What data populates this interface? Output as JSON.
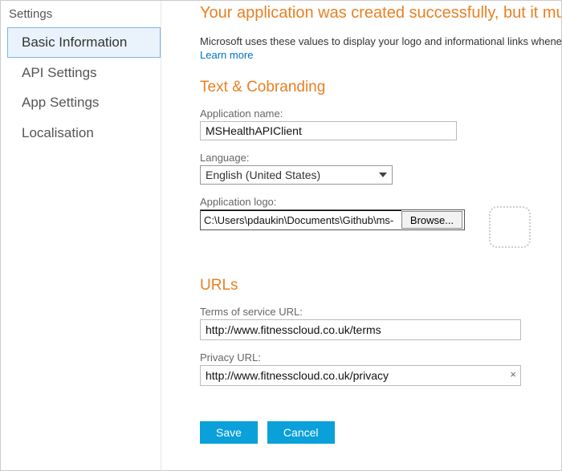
{
  "sidebar": {
    "title": "Settings",
    "items": [
      {
        "label": "Basic Information",
        "active": true
      },
      {
        "label": "API Settings",
        "active": false
      },
      {
        "label": "App Settings",
        "active": false
      },
      {
        "label": "Localisation",
        "active": false
      }
    ]
  },
  "alert": {
    "heading": "Your application was created successfully, but it must be co",
    "desc": "Microsoft uses these values to display your logo and informational links whenev",
    "learn_more": "Learn more"
  },
  "sections": {
    "cobranding": {
      "title": "Text & Cobranding",
      "app_name_label": "Application name:",
      "app_name_value": "MSHealthAPIClient",
      "language_label": "Language:",
      "language_value": "English (United States)",
      "app_logo_label": "Application logo:",
      "app_logo_path": "C:\\Users\\pdaukin\\Documents\\Github\\ms-",
      "browse_label": "Browse..."
    },
    "urls": {
      "title": "URLs",
      "tos_label": "Terms of service URL:",
      "tos_value": "http://www.fitnesscloud.co.uk/terms",
      "privacy_label": "Privacy URL:",
      "privacy_value": "http://www.fitnesscloud.co.uk/privacy"
    }
  },
  "buttons": {
    "save": "Save",
    "cancel": "Cancel"
  }
}
